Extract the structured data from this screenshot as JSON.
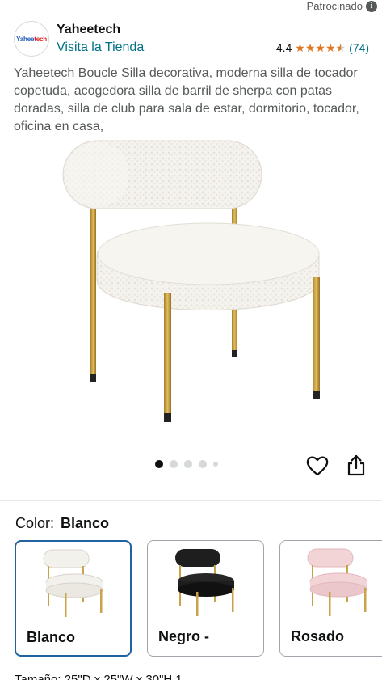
{
  "sponsored": {
    "label": "Patrocinado",
    "icon": "info-icon"
  },
  "brand": {
    "logo_text_a": "Yahee",
    "logo_text_b": "tech",
    "name": "Yaheetech",
    "store_link": "Visita la Tienda",
    "rating_value": "4.4",
    "stars": 4.4,
    "review_count": "(74)"
  },
  "product": {
    "title": "Yaheetech Boucle Silla decorativa, moderna silla de tocador copetuda, acogedora silla de barril de sherpa con patas doradas, silla de club para sala de estar, dormitorio, tocador, oficina en casa,",
    "image_icon": "white-boucle-chair-image",
    "carousel_total": 5,
    "carousel_active": 1
  },
  "actions": {
    "wishlist_icon": "heart-icon",
    "share_icon": "share-icon"
  },
  "color": {
    "label": "Color:",
    "selected": "Blanco",
    "options": [
      {
        "label": "Blanco",
        "seat": "#f3f1ec",
        "shade": "#dedbd3"
      },
      {
        "label": "Negro -",
        "seat": "#1e1e1e",
        "shade": "#0a0a0a"
      },
      {
        "label": "Rosado",
        "seat": "#f2d3d6",
        "shade": "#e2b9bd"
      }
    ]
  },
  "colors": {
    "link": "#007185",
    "star": "#de7921",
    "selected_border": "#2162a1",
    "gold": "#c9a24a"
  },
  "size_row_partial": "Tamaño: 25\"D x 25\"W x 30\"H 1"
}
